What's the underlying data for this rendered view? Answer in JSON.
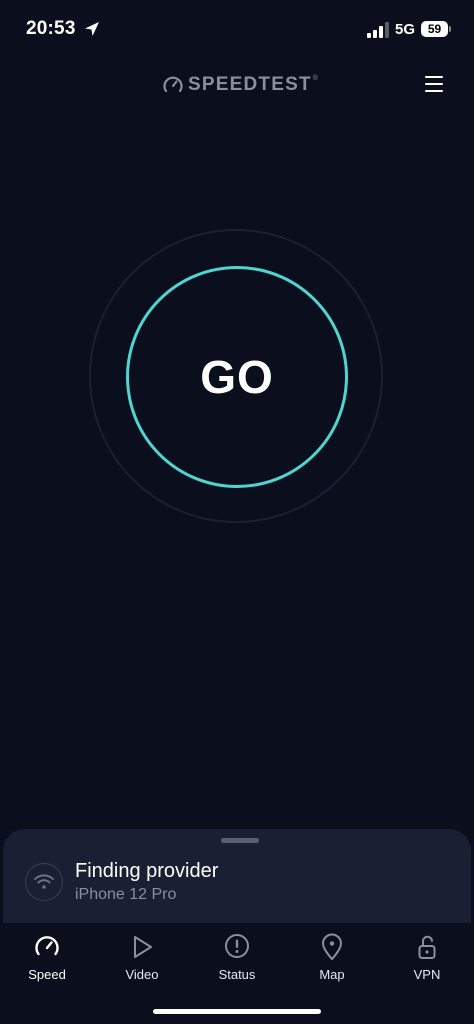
{
  "status_bar": {
    "time": "20:53",
    "network": "5G",
    "battery": "59"
  },
  "header": {
    "logo_text": "SPEEDTEST",
    "logo_tm": "®",
    "menu_icon": "hamburger-menu-icon"
  },
  "main": {
    "go_label": "GO",
    "accent_color": "#4fd4d0"
  },
  "provider": {
    "title": "Finding provider",
    "device": "iPhone 12 Pro",
    "icon": "wifi-icon"
  },
  "tabs": [
    {
      "label": "Speed",
      "icon": "speedometer-icon",
      "active": true
    },
    {
      "label": "Video",
      "icon": "play-icon",
      "active": false
    },
    {
      "label": "Status",
      "icon": "alert-icon",
      "active": false
    },
    {
      "label": "Map",
      "icon": "map-pin-icon",
      "active": false
    },
    {
      "label": "VPN",
      "icon": "unlock-icon",
      "active": false
    }
  ]
}
